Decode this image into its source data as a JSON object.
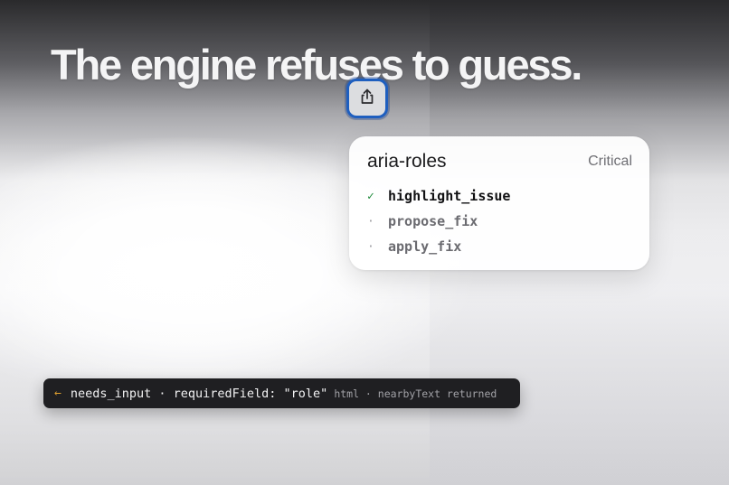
{
  "headline": "The engine refuses to guess.",
  "share_button": {
    "icon": "share-icon",
    "accent": "#1f5fbf"
  },
  "card": {
    "title": "aria-roles",
    "severity": "Critical",
    "steps": [
      {
        "mark": "✓",
        "label": "highlight_issue",
        "state": "done"
      },
      {
        "mark": "·",
        "label": "propose_fix",
        "state": "pending"
      },
      {
        "mark": "·",
        "label": "apply_fix",
        "state": "pending"
      }
    ]
  },
  "toast": {
    "arrow": "←",
    "message": "needs_input · requiredField: \"role\"",
    "meta": "html · nearbyText returned",
    "colors": {
      "background": "#1f1f22",
      "arrow": "#e0a030"
    }
  }
}
